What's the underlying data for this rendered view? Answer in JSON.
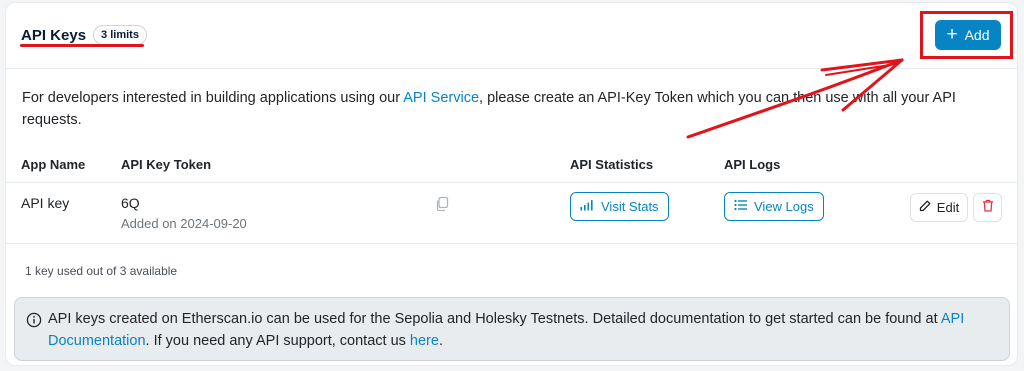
{
  "header": {
    "title": "API Keys",
    "limit_badge": "3 limits",
    "add_button_label": "Add"
  },
  "description": {
    "text_before": "For developers interested in building applications using our ",
    "link_text": "API Service",
    "text_after": ", please create an API-Key Token which you can then use with all your API requests."
  },
  "table": {
    "columns": [
      "App Name",
      "API Key Token",
      "API Statistics",
      "API Logs"
    ],
    "rows": [
      {
        "app_name": "API key",
        "token": "6Q",
        "added": "Added on 2024-09-20",
        "stats_button": "Visit Stats",
        "logs_button": "View Logs",
        "edit_button": "Edit"
      }
    ]
  },
  "usage_text": "1 key used out of 3 available",
  "info": {
    "text_1": "API keys created on Etherscan.io can be used for the Sepolia and Holesky Testnets. Detailed documentation to get started can be found at ",
    "link_1": "API Documentation",
    "text_2": ". If you need any API support, contact us ",
    "link_2": "here",
    "text_3": "."
  },
  "colors": {
    "accent": "#0784c3",
    "annotation_red": "#e0141b",
    "delete_red": "#dc3545"
  },
  "icons": [
    "plus-icon",
    "copy-icon",
    "bar-chart-icon",
    "list-icon",
    "pencil-icon",
    "trash-icon",
    "info-circle-icon"
  ]
}
